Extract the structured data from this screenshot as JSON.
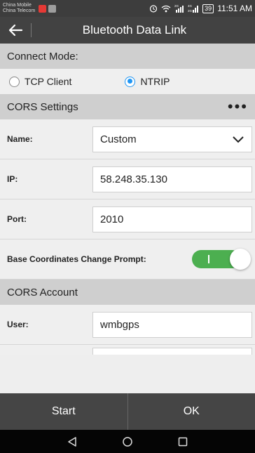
{
  "status_bar": {
    "carrier_1": "China Mobile",
    "carrier_2": "China Telecom",
    "signal_1_label": "2G",
    "signal_2_label": "4G 2G",
    "battery": "39",
    "time": "11:51 AM"
  },
  "app_bar": {
    "title": "Bluetooth Data Link",
    "back_icon": "arrow-left-icon"
  },
  "connect_mode": {
    "header": "Connect Mode:",
    "options": [
      {
        "label": "TCP Client",
        "selected": false
      },
      {
        "label": "NTRIP",
        "selected": true
      }
    ],
    "accent_color": "#2196f3"
  },
  "cors_settings": {
    "header": "CORS Settings",
    "more_icon": "more-horiz-icon",
    "name_label": "Name:",
    "name_value": "Custom",
    "ip_label": "IP:",
    "ip_value": "58.248.35.130",
    "port_label": "Port:",
    "port_value": "2010",
    "prompt_label": "Base Coordinates Change Prompt:",
    "prompt_on": true,
    "toggle_color": "#4caf50"
  },
  "cors_account": {
    "header": "CORS Account",
    "user_label": "User:",
    "user_value": "wmbgps"
  },
  "bottom_bar": {
    "start_label": "Start",
    "ok_label": "OK"
  },
  "nav_bar": {
    "back_icon": "nav-back-icon",
    "home_icon": "nav-home-icon",
    "recent_icon": "nav-recent-icon"
  }
}
